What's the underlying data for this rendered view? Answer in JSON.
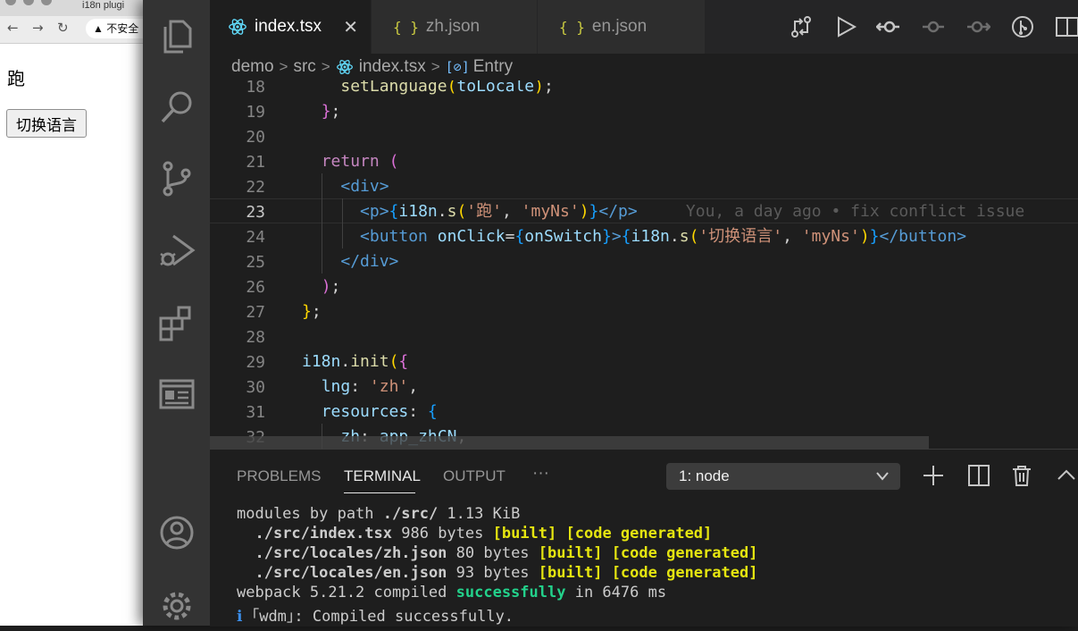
{
  "browser": {
    "tab_title": "i18n plugi",
    "nav": {
      "back": "←",
      "forward": "→",
      "reload": "↻"
    },
    "security_label": "不安全",
    "page": {
      "text": "跑",
      "button": "切换语言"
    }
  },
  "vscode": {
    "tabs": [
      {
        "label": "index.tsx",
        "icon": "react-icon",
        "active": true
      },
      {
        "label": "zh.json",
        "icon": "json-icon",
        "active": false
      },
      {
        "label": "en.json",
        "icon": "json-icon",
        "active": false
      }
    ],
    "json_icon_glyph": "{ }",
    "close_glyph": "✕",
    "breadcrumb": [
      "demo",
      "src",
      "index.tsx",
      "Entry"
    ],
    "breadcrumb_sep": ">",
    "editor": {
      "current_line": 23,
      "line_numbers": [
        "18",
        "19",
        "20",
        "21",
        "22",
        "23",
        "24",
        "25",
        "26",
        "27",
        "28",
        "29",
        "30",
        "31",
        "32"
      ],
      "lines": [
        {
          "n": "18",
          "indent": "    ",
          "tokens": [
            [
              "fn",
              "setLanguage"
            ],
            [
              "br1",
              "("
            ],
            [
              "var",
              "toLocale"
            ],
            [
              "br1",
              ")"
            ],
            [
              "plain",
              ";"
            ]
          ]
        },
        {
          "n": "19",
          "indent": "  ",
          "tokens": [
            [
              "br2",
              "}"
            ],
            [
              "plain",
              ";"
            ]
          ]
        },
        {
          "n": "20",
          "indent": "",
          "tokens": []
        },
        {
          "n": "21",
          "indent": "  ",
          "tokens": [
            [
              "kw",
              "return"
            ],
            [
              "plain",
              " "
            ],
            [
              "br2",
              "("
            ]
          ]
        },
        {
          "n": "22",
          "indent": "    ",
          "tokens": [
            [
              "tag",
              "<div>"
            ]
          ]
        },
        {
          "n": "23",
          "indent": "      ",
          "tokens": [
            [
              "tag",
              "<p>"
            ],
            [
              "br3",
              "{"
            ],
            [
              "var",
              "i18n"
            ],
            [
              "plain",
              "."
            ],
            [
              "fn",
              "s"
            ],
            [
              "br1",
              "("
            ],
            [
              "str",
              "'跑'"
            ],
            [
              "plain",
              ", "
            ],
            [
              "str",
              "'myNs'"
            ],
            [
              "br1",
              ")"
            ],
            [
              "br3",
              "}"
            ],
            [
              "tag",
              "</p>"
            ],
            [
              "plain",
              "   "
            ],
            [
              "ghost",
              "  You, a day ago • fix conflict issue"
            ]
          ]
        },
        {
          "n": "24",
          "indent": "      ",
          "tokens": [
            [
              "tag",
              "<button "
            ],
            [
              "attr",
              "onClick"
            ],
            [
              "plain",
              "="
            ],
            [
              "br3",
              "{"
            ],
            [
              "var",
              "onSwitch"
            ],
            [
              "br3",
              "}"
            ],
            [
              "tag",
              ">"
            ],
            [
              "br3",
              "{"
            ],
            [
              "var",
              "i18n"
            ],
            [
              "plain",
              "."
            ],
            [
              "fn",
              "s"
            ],
            [
              "br1",
              "("
            ],
            [
              "str",
              "'切换语言'"
            ],
            [
              "plain",
              ", "
            ],
            [
              "str",
              "'myNs'"
            ],
            [
              "br1",
              ")"
            ],
            [
              "br3",
              "}"
            ],
            [
              "tag",
              "</button>"
            ]
          ]
        },
        {
          "n": "25",
          "indent": "    ",
          "tokens": [
            [
              "tag",
              "</div>"
            ]
          ]
        },
        {
          "n": "26",
          "indent": "  ",
          "tokens": [
            [
              "br2",
              ")"
            ],
            [
              "plain",
              ";"
            ]
          ]
        },
        {
          "n": "27",
          "indent": "",
          "tokens": [
            [
              "br1",
              "}"
            ],
            [
              "plain",
              ";"
            ]
          ]
        },
        {
          "n": "28",
          "indent": "",
          "tokens": []
        },
        {
          "n": "29",
          "indent": "",
          "tokens": [
            [
              "var",
              "i18n"
            ],
            [
              "plain",
              "."
            ],
            [
              "fn",
              "init"
            ],
            [
              "br1",
              "("
            ],
            [
              "br2",
              "{"
            ]
          ]
        },
        {
          "n": "30",
          "indent": "  ",
          "tokens": [
            [
              "var",
              "lng"
            ],
            [
              "plain",
              ": "
            ],
            [
              "str",
              "'zh'"
            ],
            [
              "plain",
              ","
            ]
          ]
        },
        {
          "n": "31",
          "indent": "  ",
          "tokens": [
            [
              "var",
              "resources"
            ],
            [
              "plain",
              ": "
            ],
            [
              "br3",
              "{"
            ]
          ]
        },
        {
          "n": "32",
          "indent": "    ",
          "tokens": [
            [
              "var",
              "zh"
            ],
            [
              "plain",
              ": "
            ],
            [
              "var",
              "app_zhCN"
            ],
            [
              "plain",
              ","
            ]
          ]
        }
      ]
    },
    "panel": {
      "tabs": [
        "PROBLEMS",
        "TERMINAL",
        "OUTPUT",
        "···"
      ],
      "active_tab": "TERMINAL",
      "terminal_select": "1: node",
      "chevron": "⌄",
      "terminal_lines": [
        [
          [
            "plain",
            "modules by path "
          ],
          [
            "bold",
            "./src/"
          ],
          [
            "plain",
            " 1.13 KiB"
          ]
        ],
        [
          [
            "plain",
            "  "
          ],
          [
            "bold",
            "./src/index.tsx"
          ],
          [
            "plain",
            " 986 bytes "
          ],
          [
            "yellow",
            "[built]"
          ],
          [
            "plain",
            " "
          ],
          [
            "yellow",
            "[code generated]"
          ]
        ],
        [
          [
            "plain",
            "  "
          ],
          [
            "bold",
            "./src/locales/zh.json"
          ],
          [
            "plain",
            " 80 bytes "
          ],
          [
            "yellow",
            "[built]"
          ],
          [
            "plain",
            " "
          ],
          [
            "yellow",
            "[code generated]"
          ]
        ],
        [
          [
            "plain",
            "  "
          ],
          [
            "bold",
            "./src/locales/en.json"
          ],
          [
            "plain",
            " 93 bytes "
          ],
          [
            "yellow",
            "[built]"
          ],
          [
            "plain",
            " "
          ],
          [
            "yellow",
            "[code generated]"
          ]
        ],
        [
          [
            "plain",
            "webpack 5.21.2 compiled "
          ],
          [
            "green",
            "successfully"
          ],
          [
            "plain",
            " in 6476 ms"
          ]
        ],
        [
          [
            "blue",
            "ℹ"
          ],
          [
            "plain",
            " ｢wdm｣: Compiled successfully."
          ]
        ]
      ]
    }
  }
}
